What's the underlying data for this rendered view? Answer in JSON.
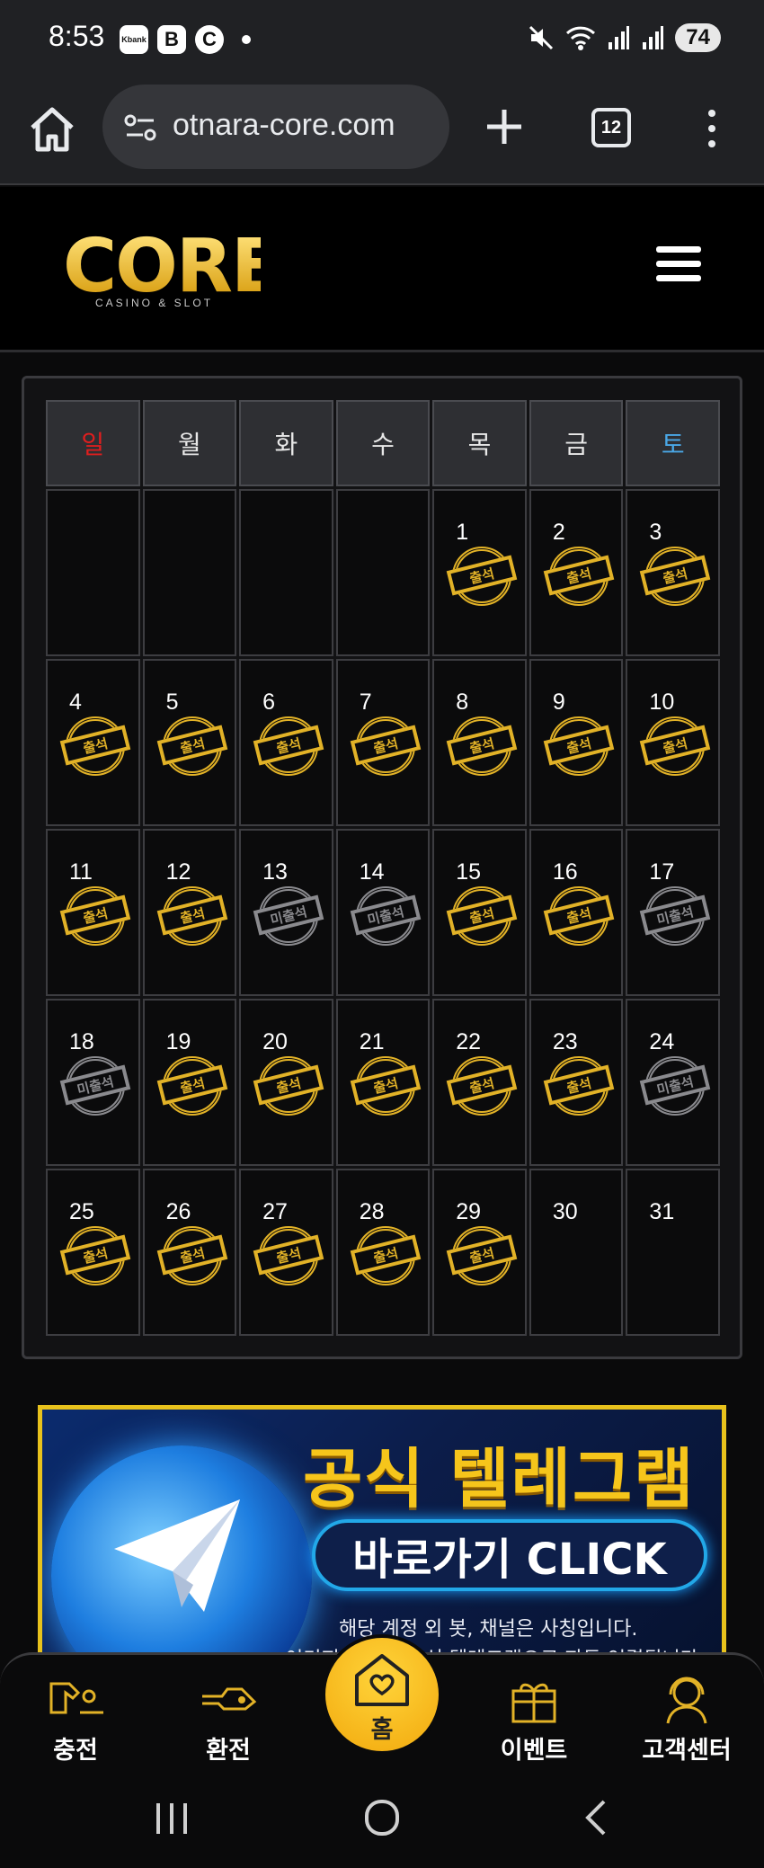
{
  "status_bar": {
    "time": "8:53",
    "apps": [
      "Kbank",
      "B",
      "C"
    ],
    "battery": "74"
  },
  "browser": {
    "url": "otnara-core.com",
    "tab_count": "12"
  },
  "site": {
    "logo_text": "CORE",
    "logo_sub": "CASINO & SLOT"
  },
  "calendar": {
    "weekdays": [
      "일",
      "월",
      "화",
      "수",
      "목",
      "금",
      "토"
    ],
    "stamp_attended": "출석",
    "stamp_missed": "미출석",
    "leading_blanks": 4,
    "days": [
      {
        "day": "1",
        "status": "attended"
      },
      {
        "day": "2",
        "status": "attended"
      },
      {
        "day": "3",
        "status": "attended"
      },
      {
        "day": "4",
        "status": "attended"
      },
      {
        "day": "5",
        "status": "attended"
      },
      {
        "day": "6",
        "status": "attended"
      },
      {
        "day": "7",
        "status": "attended"
      },
      {
        "day": "8",
        "status": "attended"
      },
      {
        "day": "9",
        "status": "attended"
      },
      {
        "day": "10",
        "status": "attended"
      },
      {
        "day": "11",
        "status": "attended"
      },
      {
        "day": "12",
        "status": "attended"
      },
      {
        "day": "13",
        "status": "missed"
      },
      {
        "day": "14",
        "status": "missed"
      },
      {
        "day": "15",
        "status": "attended"
      },
      {
        "day": "16",
        "status": "attended"
      },
      {
        "day": "17",
        "status": "missed"
      },
      {
        "day": "18",
        "status": "missed"
      },
      {
        "day": "19",
        "status": "attended"
      },
      {
        "day": "20",
        "status": "attended"
      },
      {
        "day": "21",
        "status": "attended"
      },
      {
        "day": "22",
        "status": "attended"
      },
      {
        "day": "23",
        "status": "attended"
      },
      {
        "day": "24",
        "status": "missed"
      },
      {
        "day": "25",
        "status": "attended"
      },
      {
        "day": "26",
        "status": "attended"
      },
      {
        "day": "27",
        "status": "attended"
      },
      {
        "day": "28",
        "status": "attended"
      },
      {
        "day": "29",
        "status": "attended"
      },
      {
        "day": "30",
        "status": "none"
      },
      {
        "day": "31",
        "status": "none"
      }
    ]
  },
  "banner": {
    "title": "공식 텔레그램",
    "cta": "바로가기 CLICK",
    "note": "해당 계정 외 봇, 채널은 사칭입니다.",
    "note2": "이미지 클릭시 공식 텔레그램으로 자동 연결됩니다"
  },
  "bottom_nav": {
    "charge": "충전",
    "exchange": "환전",
    "home": "홈",
    "event": "이벤트",
    "support": "고객센터"
  },
  "colors": {
    "gold": "#e2b227",
    "sunday": "#e01e1e",
    "saturday": "#4aa7e6"
  }
}
